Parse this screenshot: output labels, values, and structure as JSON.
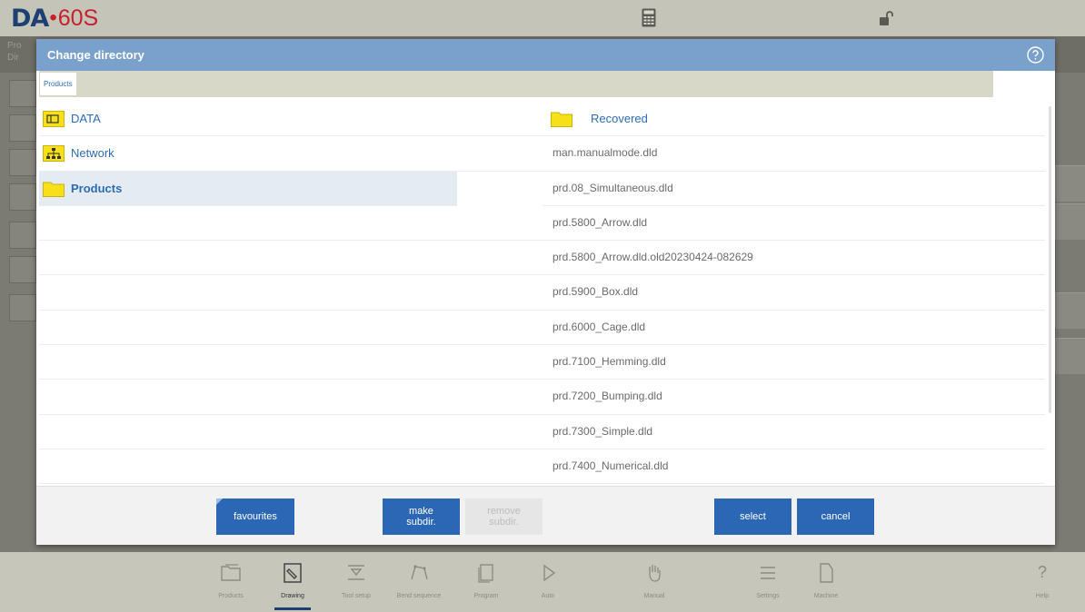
{
  "app": {
    "logo_brand": "DA",
    "logo_model": "60S",
    "calculator_icon": "calculator-icon",
    "lock_icon": "unlock-icon"
  },
  "background": {
    "strip_text_1": "Pro",
    "strip_text_2": "Dir"
  },
  "dialog": {
    "title": "Change directory",
    "help_icon": "help-circle-icon",
    "breadcrumb": [
      "Products"
    ],
    "left_list": [
      {
        "label": "DATA",
        "icon": "data-folder-icon",
        "selected": false
      },
      {
        "label": "Network",
        "icon": "network-folder-icon",
        "selected": false
      },
      {
        "label": "Products",
        "icon": "folder-icon",
        "selected": true
      }
    ],
    "right_list": [
      {
        "label": "Recovered",
        "type": "folder",
        "icon": "folder-icon"
      },
      {
        "label": "man.manualmode.dld",
        "type": "file"
      },
      {
        "label": "prd.08_Simultaneous.dld",
        "type": "file"
      },
      {
        "label": "prd.5800_Arrow.dld",
        "type": "file"
      },
      {
        "label": "prd.5800_Arrow.dld.old20230424-082629",
        "type": "file"
      },
      {
        "label": "prd.5900_Box.dld",
        "type": "file"
      },
      {
        "label": "prd.6000_Cage.dld",
        "type": "file"
      },
      {
        "label": "prd.7100_Hemming.dld",
        "type": "file"
      },
      {
        "label": "prd.7200_Bumping.dld",
        "type": "file"
      },
      {
        "label": "prd.7300_Simple.dld",
        "type": "file"
      },
      {
        "label": "prd.7400_Numerical.dld",
        "type": "file"
      }
    ],
    "buttons": {
      "favourites": "favourites",
      "make_subdir_1": "make",
      "make_subdir_2": "subdir.",
      "remove_subdir_1": "remove",
      "remove_subdir_2": "subdir.",
      "select": "select",
      "cancel": "cancel"
    }
  },
  "bottom_nav": {
    "items": [
      {
        "label": "Products",
        "icon": "products-folder-icon"
      },
      {
        "label": "Drawing",
        "icon": "drawing-pencil-icon",
        "active": true
      },
      {
        "label": "Tool setup",
        "icon": "tool-setup-icon"
      },
      {
        "label": "Bend sequence",
        "icon": "bend-sequence-icon"
      },
      {
        "label": "Program",
        "icon": "program-icon"
      },
      {
        "label": "Auto",
        "icon": "auto-play-icon"
      },
      {
        "label": "Manual",
        "icon": "manual-hand-icon"
      },
      {
        "label": "Settings",
        "icon": "settings-list-icon"
      },
      {
        "label": "Machine",
        "icon": "machine-icon"
      }
    ],
    "help_label": "Help",
    "help_glyph": "?"
  },
  "colors": {
    "header_blue": "#7aa0cc",
    "button_blue": "#2b67b4",
    "link_blue": "#2d6cb5",
    "folder_yellow": "#f7e01a",
    "logo_red": "#c8202a",
    "logo_navy": "#1e3f72"
  }
}
